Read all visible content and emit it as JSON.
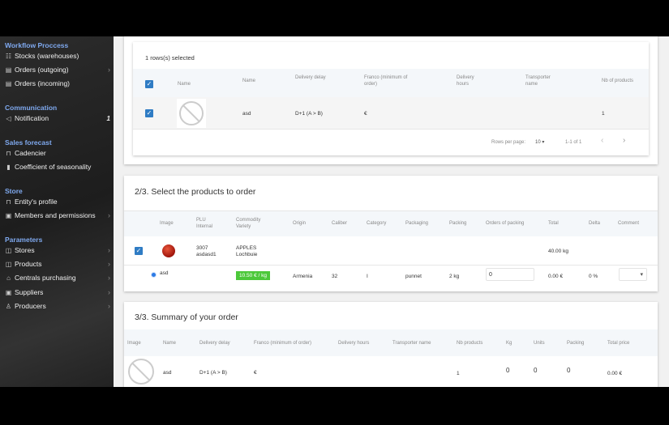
{
  "sidebar": {
    "sections": [
      {
        "title": "Workflow Proccess",
        "items": [
          {
            "label": "Stocks (warehouses)",
            "icon": "warehouse-icon"
          },
          {
            "label": "Orders (outgoing)",
            "icon": "calendar-icon",
            "chevron": true
          },
          {
            "label": "Orders (incoming)",
            "icon": "calendar-icon"
          }
        ]
      },
      {
        "title": "Communication",
        "items": [
          {
            "label": "Notification",
            "icon": "megaphone-icon",
            "badge": "1"
          }
        ]
      },
      {
        "title": "Sales forecast",
        "items": [
          {
            "label": "Cadencier",
            "icon": "cart-icon"
          },
          {
            "label": "Coefficient of seasonality",
            "icon": "bar-chart-icon"
          }
        ]
      },
      {
        "title": "Store",
        "items": [
          {
            "label": "Entity's profile",
            "icon": "cart-icon"
          },
          {
            "label": "Members and permissions",
            "icon": "id-card-icon",
            "chevron": true
          }
        ]
      },
      {
        "title": "Parameters",
        "items": [
          {
            "label": "Stores",
            "icon": "box-icon",
            "chevron": true
          },
          {
            "label": "Products",
            "icon": "box-icon",
            "chevron": true
          },
          {
            "label": "Centrals purchasing",
            "icon": "building-icon",
            "chevron": true
          },
          {
            "label": "Suppliers",
            "icon": "id-card-icon",
            "chevron": true
          },
          {
            "label": "Producers",
            "icon": "user-icon",
            "chevron": true
          }
        ]
      }
    ]
  },
  "step1": {
    "selected_text": "1 rows(s) selected",
    "headers": [
      "Name",
      "Name",
      "Delivery delay",
      "Franco (minimum of order)",
      "Delivery hours",
      "Transporter name",
      "Nb of products"
    ],
    "row": {
      "name": "asd",
      "delay": "D+1 (A > B)",
      "franco": "€",
      "hours": "",
      "transporter": "",
      "nb": "1"
    },
    "footer": {
      "rows_per_page_label": "Rows per page:",
      "rows_per_page": "10",
      "range": "1-1 of 1"
    }
  },
  "step2": {
    "title": "2/3. Select the products to order",
    "headers": [
      "Image",
      "PLU Internal",
      "Commodity Variety",
      "Origin",
      "Caliber",
      "Category",
      "Packaging",
      "Packing",
      "Orders of packing",
      "Total",
      "Delta",
      "Comment"
    ],
    "product": {
      "plu": "3007",
      "internal": "asdasd1",
      "commodity": "APPLES",
      "variety": "Lochbuie",
      "total": "40.00 kg"
    },
    "offer": {
      "name": "asd",
      "price": "10.50 € / kg",
      "origin": "Armenia",
      "caliber": "32",
      "category": "I",
      "packaging": "punnet",
      "packing": "2 kg",
      "orders_value": "0",
      "total": "0.00 €",
      "delta": "0 %"
    },
    "price_color": "#4cc83a"
  },
  "step3": {
    "title": "3/3. Summary of your order",
    "headers": [
      "Image",
      "Name",
      "Delivery delay",
      "Franco (minimum of order)",
      "Delivery hours",
      "Transporter name",
      "Nb products",
      "Kg",
      "Units",
      "Packing",
      "Total price"
    ],
    "row": {
      "name": "asd",
      "delay": "D+1 (A > B)",
      "franco": "€",
      "nb": "1",
      "kg": "0",
      "units": "0",
      "packing": "0",
      "total": "0.00 €"
    }
  }
}
